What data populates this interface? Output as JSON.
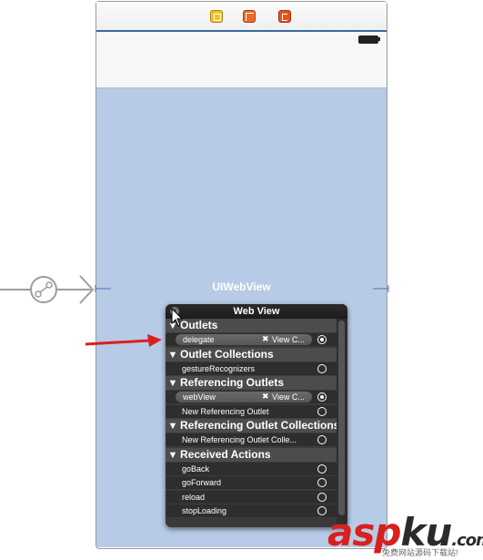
{
  "canvas": {
    "uiwebview_label": "UIWebView"
  },
  "scene_dock": {
    "icons": [
      "view-controller-icon",
      "first-responder-icon",
      "exit-icon"
    ]
  },
  "popover": {
    "title": "Web View",
    "close_glyph": "x",
    "sections": [
      {
        "header": "Outlets",
        "rows": [
          {
            "label": "delegate",
            "connected": true,
            "target": "View C...",
            "remove_glyph": "✖"
          }
        ]
      },
      {
        "header": "Outlet Collections",
        "rows": [
          {
            "label": "gestureRecognizers",
            "connected": false
          }
        ]
      },
      {
        "header": "Referencing Outlets",
        "rows": [
          {
            "label": "webView",
            "connected": true,
            "target": "View C...",
            "remove_glyph": "✖"
          },
          {
            "label": "New Referencing Outlet",
            "connected": false
          }
        ]
      },
      {
        "header": "Referencing Outlet Collections",
        "rows": [
          {
            "label": "New Referencing Outlet Colle...",
            "connected": false
          }
        ]
      },
      {
        "header": "Received Actions",
        "rows": [
          {
            "label": "goBack",
            "connected": false
          },
          {
            "label": "goForward",
            "connected": false
          },
          {
            "label": "reload",
            "connected": false
          },
          {
            "label": "stopLoading",
            "connected": false
          }
        ]
      }
    ]
  },
  "watermark": {
    "brand_a": "asp",
    "brand_b": "ku",
    "brand_c": ".com",
    "subtitle": "免费网站源码下载站!"
  },
  "colors": {
    "web_view_bg": "#b7cbe6",
    "annotation_arrow": "#d9201e",
    "popover_bg": "#3a3a3a"
  }
}
